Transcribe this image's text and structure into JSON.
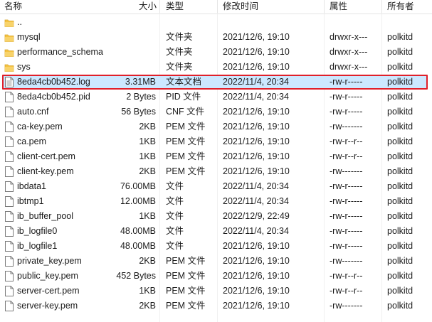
{
  "columns": {
    "name": "名称",
    "size": "大小",
    "type": "类型",
    "modified": "修改时间",
    "permissions": "属性",
    "owner": "所有者"
  },
  "rows": [
    {
      "icon": "folder-icon",
      "name": "..",
      "size": "",
      "type": "",
      "modified": "",
      "perm": "",
      "owner": ""
    },
    {
      "icon": "folder-icon",
      "name": "mysql",
      "size": "",
      "type": "文件夹",
      "modified": "2021/12/6, 19:10",
      "perm": "drwxr-x---",
      "owner": "polkitd"
    },
    {
      "icon": "folder-icon",
      "name": "performance_schema",
      "size": "",
      "type": "文件夹",
      "modified": "2021/12/6, 19:10",
      "perm": "drwxr-x---",
      "owner": "polkitd"
    },
    {
      "icon": "folder-icon",
      "name": "sys",
      "size": "",
      "type": "文件夹",
      "modified": "2021/12/6, 19:10",
      "perm": "drwxr-x---",
      "owner": "polkitd"
    },
    {
      "icon": "text-file-icon",
      "name": "8eda4cb0b452.log",
      "size": "3.31MB",
      "type": "文本文档",
      "modified": "2022/11/4, 20:34",
      "perm": "-rw-r-----",
      "owner": "polkitd",
      "selected": true
    },
    {
      "icon": "file-icon",
      "name": "8eda4cb0b452.pid",
      "size": "2 Bytes",
      "type": "PID 文件",
      "modified": "2022/11/4, 20:34",
      "perm": "-rw-r-----",
      "owner": "polkitd"
    },
    {
      "icon": "file-icon",
      "name": "auto.cnf",
      "size": "56 Bytes",
      "type": "CNF 文件",
      "modified": "2021/12/6, 19:10",
      "perm": "-rw-r-----",
      "owner": "polkitd"
    },
    {
      "icon": "file-icon",
      "name": "ca-key.pem",
      "size": "2KB",
      "type": "PEM 文件",
      "modified": "2021/12/6, 19:10",
      "perm": "-rw-------",
      "owner": "polkitd"
    },
    {
      "icon": "file-icon",
      "name": "ca.pem",
      "size": "1KB",
      "type": "PEM 文件",
      "modified": "2021/12/6, 19:10",
      "perm": "-rw-r--r--",
      "owner": "polkitd"
    },
    {
      "icon": "file-icon",
      "name": "client-cert.pem",
      "size": "1KB",
      "type": "PEM 文件",
      "modified": "2021/12/6, 19:10",
      "perm": "-rw-r--r--",
      "owner": "polkitd"
    },
    {
      "icon": "file-icon",
      "name": "client-key.pem",
      "size": "2KB",
      "type": "PEM 文件",
      "modified": "2021/12/6, 19:10",
      "perm": "-rw-------",
      "owner": "polkitd"
    },
    {
      "icon": "file-icon",
      "name": "ibdata1",
      "size": "76.00MB",
      "type": "文件",
      "modified": "2022/11/4, 20:34",
      "perm": "-rw-r-----",
      "owner": "polkitd"
    },
    {
      "icon": "file-icon",
      "name": "ibtmp1",
      "size": "12.00MB",
      "type": "文件",
      "modified": "2022/11/4, 20:34",
      "perm": "-rw-r-----",
      "owner": "polkitd"
    },
    {
      "icon": "file-icon",
      "name": "ib_buffer_pool",
      "size": "1KB",
      "type": "文件",
      "modified": "2022/12/9, 22:49",
      "perm": "-rw-r-----",
      "owner": "polkitd"
    },
    {
      "icon": "file-icon",
      "name": "ib_logfile0",
      "size": "48.00MB",
      "type": "文件",
      "modified": "2022/11/4, 20:34",
      "perm": "-rw-r-----",
      "owner": "polkitd"
    },
    {
      "icon": "file-icon",
      "name": "ib_logfile1",
      "size": "48.00MB",
      "type": "文件",
      "modified": "2021/12/6, 19:10",
      "perm": "-rw-r-----",
      "owner": "polkitd"
    },
    {
      "icon": "file-icon",
      "name": "private_key.pem",
      "size": "2KB",
      "type": "PEM 文件",
      "modified": "2021/12/6, 19:10",
      "perm": "-rw-------",
      "owner": "polkitd"
    },
    {
      "icon": "file-icon",
      "name": "public_key.pem",
      "size": "452 Bytes",
      "type": "PEM 文件",
      "modified": "2021/12/6, 19:10",
      "perm": "-rw-r--r--",
      "owner": "polkitd"
    },
    {
      "icon": "file-icon",
      "name": "server-cert.pem",
      "size": "1KB",
      "type": "PEM 文件",
      "modified": "2021/12/6, 19:10",
      "perm": "-rw-r--r--",
      "owner": "polkitd"
    },
    {
      "icon": "file-icon",
      "name": "server-key.pem",
      "size": "2KB",
      "type": "PEM 文件",
      "modified": "2021/12/6, 19:10",
      "perm": "-rw-------",
      "owner": "polkitd"
    }
  ],
  "colors": {
    "folder": "#f5c342",
    "selection": "#cce8ff",
    "highlight_border": "#e0202a"
  }
}
